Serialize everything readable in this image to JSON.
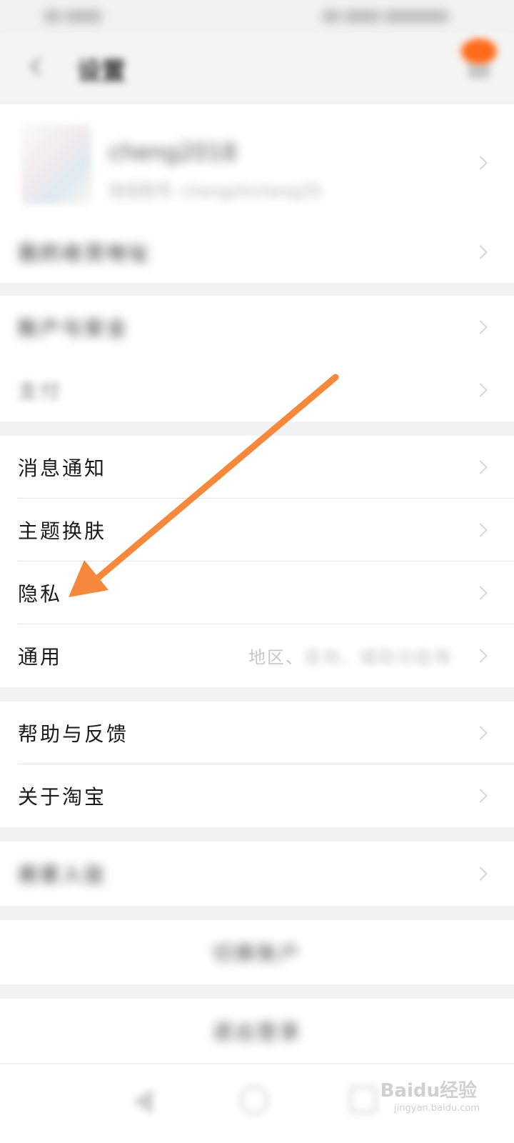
{
  "header": {
    "title": "设置"
  },
  "profile": {
    "username": "cheng2018",
    "account_line": "淘宝账号: chengshicheng29"
  },
  "groups": [
    {
      "items": [
        {
          "label": "我的收货地址"
        }
      ]
    },
    {
      "items": [
        {
          "label": "账户与安全"
        },
        {
          "label": "支付"
        }
      ]
    },
    {
      "items": [
        {
          "label": "消息通知"
        },
        {
          "label": "主题换肤"
        },
        {
          "label": "隐私"
        },
        {
          "label": "通用",
          "value_visible": "地区、",
          "value_blurred": "音效、辅助功能等"
        }
      ]
    },
    {
      "items": [
        {
          "label": "帮助与反馈"
        },
        {
          "label": "关于淘宝"
        }
      ]
    },
    {
      "items": [
        {
          "label": "商家入驻"
        }
      ]
    }
  ],
  "buttons": {
    "switch_account": "切换账户",
    "logout": "退出登录"
  },
  "watermark": {
    "brand": "Baidu经验",
    "url": "jingyan.baidu.com"
  },
  "colors": {
    "accent": "#ff6a1a",
    "annotation_arrow": "#f5883a"
  },
  "icons": {
    "back": "back-arrow-icon",
    "nav_back": "nav-back-icon",
    "nav_home": "nav-home-icon",
    "nav_recent": "nav-recent-icon"
  }
}
